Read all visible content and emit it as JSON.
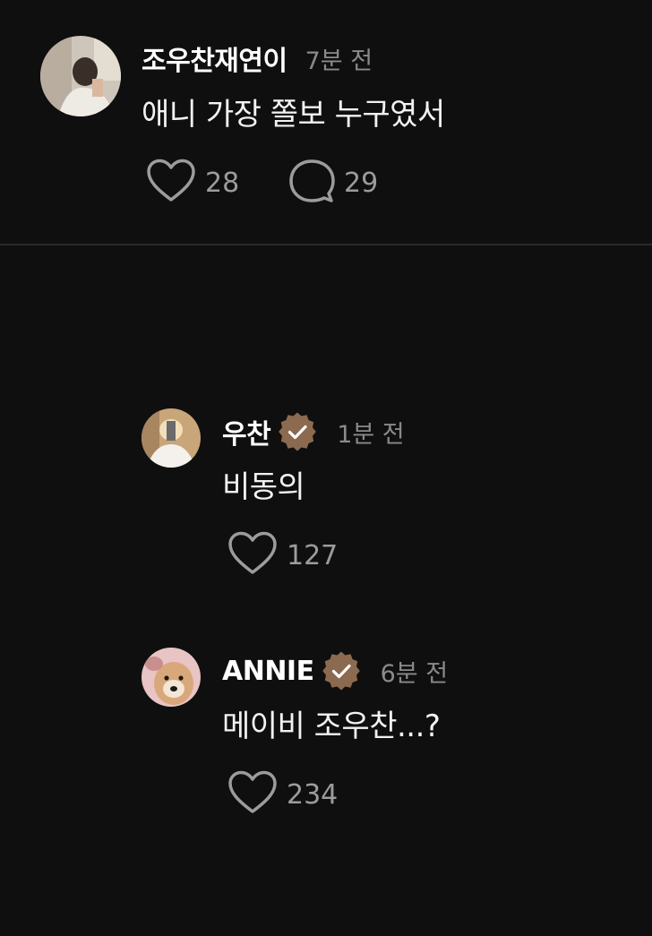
{
  "post": {
    "username": "조우찬재연이",
    "time": "7분 전",
    "text": "애니 가장 쫄보 누구였서",
    "likes": "28",
    "comments": "29"
  },
  "replies": [
    {
      "username": "우찬",
      "verified": true,
      "time": "1분 전",
      "text": "비동의",
      "likes": "127"
    },
    {
      "username": "ANNIE",
      "verified": true,
      "time": "6분 전",
      "text": "메이비 조우찬...?",
      "likes": "234"
    }
  ],
  "icons": {
    "like": "heart-icon",
    "comment": "comment-bubble-icon",
    "verified": "verified-badge-icon"
  },
  "colors": {
    "background": "#100f0f",
    "badge": "#8b6a4f",
    "muted": "#8a8a8a"
  }
}
